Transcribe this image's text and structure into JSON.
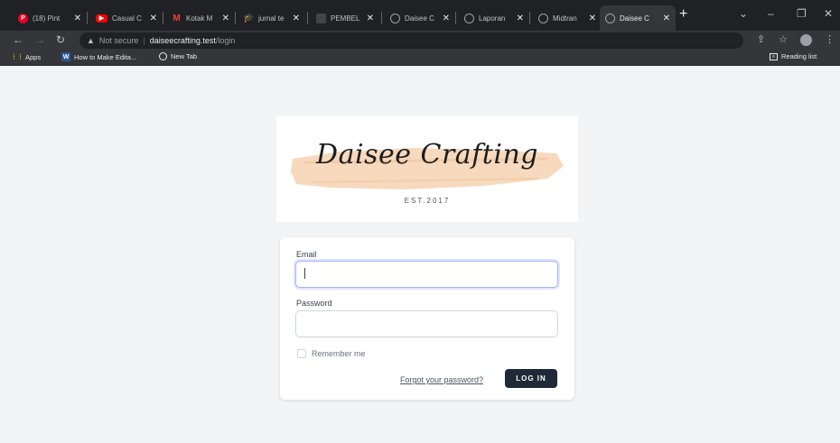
{
  "browser": {
    "tabs": [
      {
        "label": "(18) Pint",
        "icon": "pinterest-icon",
        "color": "#e60023"
      },
      {
        "label": "Casual C",
        "icon": "youtube-icon",
        "color": "#ff0000"
      },
      {
        "label": "Kotak M",
        "icon": "gmail-icon",
        "color": "#ea4335"
      },
      {
        "label": "jurnal te",
        "icon": "graduation-cap-icon",
        "color": "#4a90d9"
      },
      {
        "label": "PEMBEL",
        "icon": "page-icon",
        "color": "#444"
      },
      {
        "label": "Daisee C",
        "icon": "globe-icon",
        "color": "#9aa0a6"
      },
      {
        "label": "Laporan",
        "icon": "globe-icon",
        "color": "#9aa0a6"
      },
      {
        "label": "Midtran",
        "icon": "globe-icon",
        "color": "#9aa0a6"
      },
      {
        "label": "Daisee C",
        "icon": "globe-icon",
        "color": "#9aa0a6",
        "active": true
      }
    ],
    "address": {
      "security": "Not secure",
      "host": "daiseecrafting.test",
      "path": "/login"
    },
    "bookmarks": {
      "apps": "Apps",
      "item1": "How to Make Edita...",
      "item2": "New Tab",
      "reading_list": "Reading list"
    }
  },
  "page": {
    "logo": {
      "title": "Daisee Crafting",
      "est": "EST.2017",
      "brush_color": "#f7d9bd"
    },
    "form": {
      "email_label": "Email",
      "email_value": "",
      "password_label": "Password",
      "password_value": "",
      "remember_label": "Remember me",
      "forgot_link": "Forgot your password?",
      "login_button": "LOG IN"
    }
  }
}
